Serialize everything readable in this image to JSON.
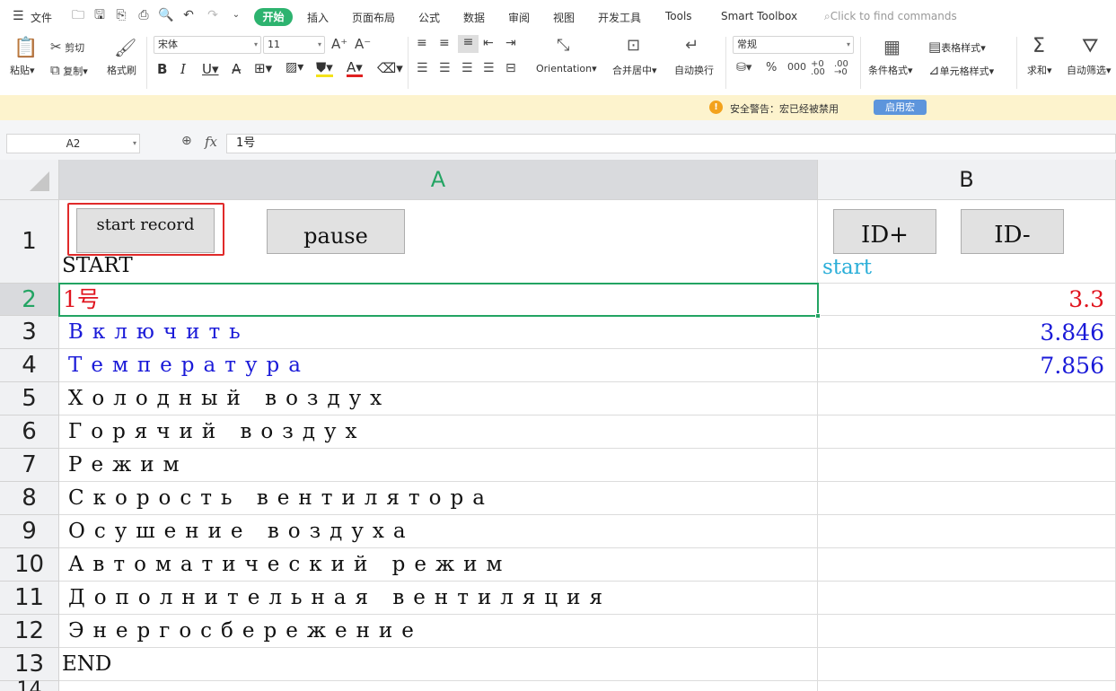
{
  "menubar": {
    "file": "文件",
    "tabs": [
      "开始",
      "插入",
      "页面布局",
      "公式",
      "数据",
      "审阅",
      "视图",
      "开发工具",
      "Tools",
      "Smart Toolbox"
    ],
    "find_placeholder": "Click to find commands"
  },
  "ribbon": {
    "paste": "粘贴",
    "cut": "剪切",
    "copy": "复制",
    "format_painter": "格式刷",
    "font_name": "宋体",
    "font_size": "11",
    "orientation": "Orientation",
    "merge_center": "合并居中",
    "wrap_text": "自动换行",
    "number_format": "常规",
    "cond_format": "条件格式",
    "table_style": "表格样式",
    "cell_style": "单元格样式",
    "sum": "求和",
    "auto_filter": "自动筛选"
  },
  "warning": {
    "icon": "warning-icon",
    "text": "安全警告：宏已经被禁用",
    "enable_button": "启用宏"
  },
  "formula_bar": {
    "name_box": "A2",
    "fx": "fx",
    "value": "1号"
  },
  "sheet": {
    "columns": [
      "A",
      "B"
    ],
    "rows": [
      "1",
      "2",
      "3",
      "4",
      "5",
      "6",
      "7",
      "8",
      "9",
      "10",
      "11",
      "12",
      "13",
      "14"
    ],
    "buttons": {
      "start_record": "start record",
      "pause": "pause",
      "id_plus": "ID+",
      "id_minus": "ID-"
    },
    "cells": {
      "A1": "START",
      "B1": "start",
      "A2": "1号",
      "B2": "3.3",
      "A3": "Включить",
      "B3": "3.846",
      "A4": "Температура",
      "B4": "7.856",
      "A5": "Холодный воздух",
      "A6": "Горячий воздух",
      "A7": "Режим",
      "A8": "Скорость вентилятора",
      "A9": "Осушение воздуха",
      "A10": "Автоматический режим",
      "A11": "Дополнительная вентиляция",
      "A12": "Энергосбережение",
      "A13": "END"
    },
    "colors": {
      "red": "#e0141e",
      "blue": "#1a1ad8",
      "cyan": "#2aaed8",
      "black": "#111111",
      "selection": "#23a463"
    }
  }
}
